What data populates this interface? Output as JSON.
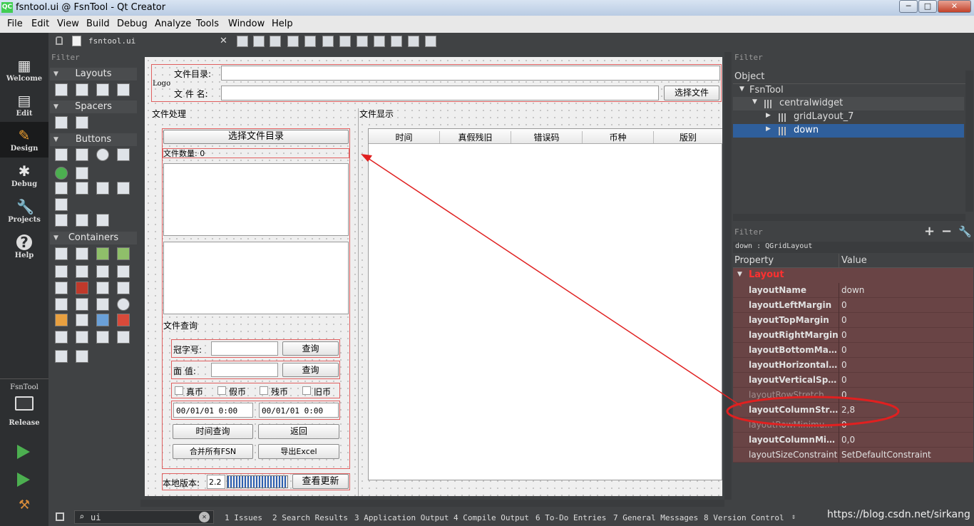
{
  "window": {
    "title": "fsntool.ui @ FsnTool - Qt Creator",
    "logo": "QC",
    "min": "─",
    "max": "□",
    "close": "✕"
  },
  "menu": [
    "File",
    "Edit",
    "View",
    "Build",
    "Debug",
    "Analyze",
    "Tools",
    "Window",
    "Help"
  ],
  "modes": [
    {
      "label": "Welcome",
      "icon": "▦"
    },
    {
      "label": "Edit",
      "icon": "▤"
    },
    {
      "label": "Design",
      "icon": "✎"
    },
    {
      "label": "Debug",
      "icon": "✱"
    },
    {
      "label": "Projects",
      "icon": "🔧"
    },
    {
      "label": "Help",
      "icon": "?"
    }
  ],
  "target": {
    "project": "FsnTool",
    "config": "Release"
  },
  "editor": {
    "file_tab": "fsntool.ui",
    "close": "✕"
  },
  "widgetbox": {
    "filter": "Filter",
    "categories": [
      "Layouts",
      "Spacers",
      "Buttons",
      "Containers"
    ]
  },
  "form": {
    "logo": "Logo",
    "dir_label": "文件目录:",
    "name_label": "文 件 名:",
    "select_file": "选择文件",
    "process_group": "文件处理",
    "display_group": "文件显示",
    "select_dir": "选择文件目录",
    "file_count": "文件数量: 0",
    "query_group": "文件查询",
    "serial_label": "冠字号:",
    "denom_label": "面  值:",
    "query_btn": "查询",
    "cb_real": "真币",
    "cb_fake": "假币",
    "cb_damaged": "残币",
    "cb_old": "旧币",
    "date1": "00/01/01 0:00",
    "date2": "00/01/01 0:00",
    "time_query": "时间查询",
    "back": "返回",
    "merge_fsn": "合并所有FSN",
    "export_excel": "导出Excel",
    "local_version_label": "本地版本:",
    "version": "2.2",
    "check_update": "查看更新",
    "table_headers": [
      "时间",
      "真假残旧",
      "错误码",
      "币种",
      "版别"
    ]
  },
  "object_inspector": {
    "filter": "Filter",
    "header": "Object",
    "items": [
      {
        "name": "FsnTool",
        "level": 0,
        "arrow": "▼"
      },
      {
        "name": "centralwidget",
        "level": 1,
        "arrow": "▼"
      },
      {
        "name": "gridLayout_7",
        "level": 2,
        "arrow": "▶"
      },
      {
        "name": "down",
        "level": 2,
        "arrow": "▶",
        "selected": true
      }
    ]
  },
  "property_editor": {
    "filter": "Filter",
    "object_label": "down : QGridLayout",
    "col_property": "Property",
    "col_value": "Value",
    "section": "Layout",
    "rows": [
      {
        "name": "layoutName",
        "value": "down"
      },
      {
        "name": "layoutLeftMargin",
        "value": "0"
      },
      {
        "name": "layoutTopMargin",
        "value": "0"
      },
      {
        "name": "layoutRightMargin",
        "value": "0"
      },
      {
        "name": "layoutBottomMar...",
        "value": "0"
      },
      {
        "name": "layoutHorizontalS...",
        "value": "0"
      },
      {
        "name": "layoutVerticalSpa...",
        "value": "0"
      },
      {
        "name": "layoutRowStretch",
        "value": "0"
      },
      {
        "name": "layoutColumnStre...",
        "value": "2,8"
      },
      {
        "name": "layoutRowMinimu...",
        "value": "0"
      },
      {
        "name": "layoutColumnMin...",
        "value": "0,0"
      },
      {
        "name": "layoutSizeConstraint",
        "value": "SetDefaultConstraint"
      }
    ]
  },
  "statusbar": {
    "locator": "ui",
    "tabs": [
      "1 Issues",
      "2 Search Results",
      "3 Application Output",
      "4 Compile Output",
      "6 To-Do Entries",
      "7 General Messages",
      "8 Version Control"
    ],
    "watermark": "https://blog.csdn.net/sirkang"
  },
  "colors": {
    "annotation": "#e02020",
    "selection": "#2f5f9c",
    "prop_row": "#694445"
  }
}
